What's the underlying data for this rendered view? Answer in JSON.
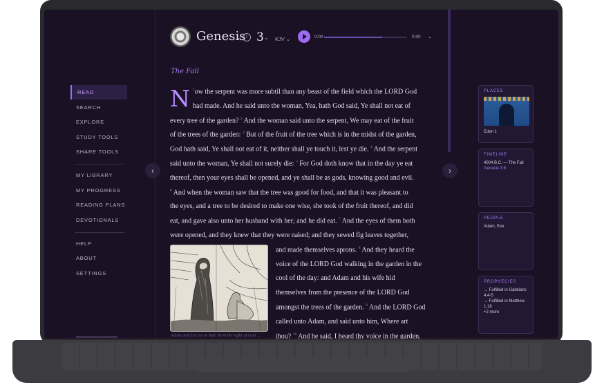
{
  "nav": {
    "items": [
      "READ",
      "SEARCH",
      "EXPLORE",
      "STUDY TOOLS",
      "SHARE TOOLS",
      "MY LIBRARY",
      "MY PROGRESS",
      "READING PLANS",
      "DEVOTIONALS",
      "HELP",
      "ABOUT",
      "SETTINGS"
    ],
    "active": "READ"
  },
  "header": {
    "book": "Genesis",
    "chapter": "3",
    "version": "KJV",
    "time_current": "0:00",
    "time_total": "0:00",
    "progress": 0.7
  },
  "reader": {
    "section_title": "The Fall",
    "dropcap": "N",
    "lines": [
      [
        {
          "v": "1"
        },
        {
          "t": "ow the serpent was more subtil than any beast of the field which the LORD God"
        }
      ],
      [
        {
          "t": "had made. And he said unto the woman, Yea, hath God said, Ye shall not eat of"
        }
      ],
      [
        {
          "t": "every tree of the garden? "
        },
        {
          "v": "2"
        },
        {
          "t": " And the woman said unto the serpent, We may eat of the fruit"
        }
      ],
      [
        {
          "t": "of the trees of the garden: "
        },
        {
          "v": "3"
        },
        {
          "t": " But of the fruit of the tree which is in the midst of the garden,"
        }
      ],
      [
        {
          "t": "God hath said, Ye shall not eat of it, neither shall ye touch it, lest ye die. "
        },
        {
          "v": "4"
        },
        {
          "t": " And the serpent"
        }
      ],
      [
        {
          "t": "said unto the woman, Ye shall not surely die: "
        },
        {
          "v": "5"
        },
        {
          "t": " For God doth know that in the day ye eat"
        }
      ],
      [
        {
          "t": "thereof, then your eyes shall be opened, and ye shall be as gods, knowing good and evil."
        }
      ],
      [
        {
          "v": "6"
        },
        {
          "t": " And when the woman saw that the tree was good for food, and that it was pleasant to"
        }
      ],
      [
        {
          "t": "the eyes, and a tree to be desired to make one wise, she took of the fruit thereof, and did"
        }
      ],
      [
        {
          "t": "eat, and gave also unto her husband with her; and he did eat. "
        },
        {
          "v": "7"
        },
        {
          "t": " And the eyes of them both"
        }
      ],
      [
        {
          "t": "were opened, and they knew that they were naked; and they sewed fig leaves together,"
        }
      ],
      [
        {
          "t": "and made themselves aprons. "
        },
        {
          "v": "8"
        },
        {
          "t": " And they heard the"
        }
      ],
      [
        {
          "t": "voice of the LORD God walking in the garden in the"
        }
      ],
      [
        {
          "t": "cool of the day: and Adam and his wife hid"
        }
      ],
      [
        {
          "t": "themselves from the presence of the LORD God"
        }
      ],
      [
        {
          "t": "amongst the trees of the garden. "
        },
        {
          "v": "9"
        },
        {
          "t": " And the LORD God"
        }
      ],
      [
        {
          "t": "called unto Adam, and said unto him, Where art"
        }
      ],
      [
        {
          "t": "thou? "
        },
        {
          "v": "10"
        },
        {
          "t": " And he said, I heard thy voice in the garden,"
        }
      ]
    ],
    "caption": "Adam and Eve try to hide from the sight of God ..."
  },
  "panels": {
    "places": {
      "label": "PLACES",
      "item": "Eden 1"
    },
    "timeline": {
      "label": "TIMELINE",
      "text": "4004 B.C. — The Fall",
      "link": "Genesis 3:6"
    },
    "people": {
      "label": "PEOPLE",
      "text": "Adam, Eve"
    },
    "prophecies": {
      "label": "PROPHECIES",
      "items": [
        "→ Fulfilled in Galatians 4:4-5",
        "→ Fulfilled in Matthew 1:18"
      ],
      "more": "+2 more"
    }
  },
  "icons": {
    "info": "info-icon",
    "play": "play-icon",
    "prev": "chevron-left-icon",
    "next": "chevron-right-icon"
  },
  "colors": {
    "accent": "#9c6bf0",
    "background": "#1a1125"
  }
}
